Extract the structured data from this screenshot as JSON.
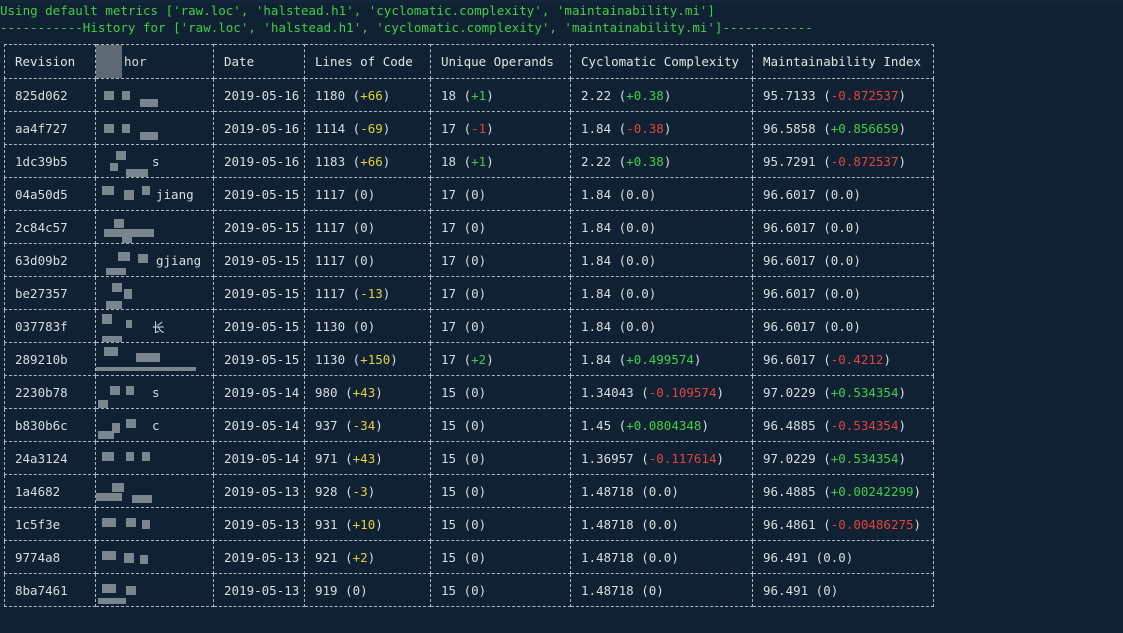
{
  "console": {
    "line1": "Using default metrics ['raw.loc', 'halstead.h1', 'cyclomatic.complexity', 'maintainability.mi']",
    "line2": "-----------History for ['raw.loc', 'halstead.h1', 'cyclomatic.complexity', 'maintainability.mi']------------"
  },
  "table": {
    "headers": [
      "Revision",
      "hor",
      "Date",
      "Lines of Code",
      "Unique Operands",
      "Cyclomatic Complexity",
      "Maintainability Index"
    ],
    "rows": [
      {
        "rev": "825d062",
        "author": "",
        "date": "2019-05-16",
        "loc": "1180",
        "loc_delta": "+66",
        "ops": "18",
        "ops_delta": "+1",
        "cc": "2.22",
        "cc_delta": "+0.38",
        "mi": "95.7133",
        "mi_delta": "-0.872537"
      },
      {
        "rev": "aa4f727",
        "author": "",
        "date": "2019-05-16",
        "loc": "1114",
        "loc_delta": "-69",
        "ops": "17",
        "ops_delta": "-1",
        "cc": "1.84",
        "cc_delta": "-0.38",
        "mi": "96.5858",
        "mi_delta": "+0.856659"
      },
      {
        "rev": "1dc39b5",
        "author": "s",
        "date": "2019-05-16",
        "loc": "1183",
        "loc_delta": "+66",
        "ops": "18",
        "ops_delta": "+1",
        "cc": "2.22",
        "cc_delta": "+0.38",
        "mi": "95.7291",
        "mi_delta": "-0.872537"
      },
      {
        "rev": "04a50d5",
        "author": "jiang",
        "date": "2019-05-15",
        "loc": "1117",
        "loc_delta": "0",
        "ops": "17",
        "ops_delta": "0",
        "cc": "1.84",
        "cc_delta": "0.0",
        "mi": "96.6017",
        "mi_delta": "0.0"
      },
      {
        "rev": "2c84c57",
        "author": "",
        "date": "2019-05-15",
        "loc": "1117",
        "loc_delta": "0",
        "ops": "17",
        "ops_delta": "0",
        "cc": "1.84",
        "cc_delta": "0.0",
        "mi": "96.6017",
        "mi_delta": "0.0"
      },
      {
        "rev": "63d09b2",
        "author": "gjiang",
        "date": "2019-05-15",
        "loc": "1117",
        "loc_delta": "0",
        "ops": "17",
        "ops_delta": "0",
        "cc": "1.84",
        "cc_delta": "0.0",
        "mi": "96.6017",
        "mi_delta": "0.0"
      },
      {
        "rev": "be27357",
        "author": "",
        "date": "2019-05-15",
        "loc": "1117",
        "loc_delta": "-13",
        "ops": "17",
        "ops_delta": "0",
        "cc": "1.84",
        "cc_delta": "0.0",
        "mi": "96.6017",
        "mi_delta": "0.0"
      },
      {
        "rev": "037783f",
        "author": "长",
        "date": "2019-05-15",
        "loc": "1130",
        "loc_delta": "0",
        "ops": "17",
        "ops_delta": "0",
        "cc": "1.84",
        "cc_delta": "0.0",
        "mi": "96.6017",
        "mi_delta": "0.0"
      },
      {
        "rev": "289210b",
        "author": "",
        "date": "2019-05-15",
        "loc": "1130",
        "loc_delta": "+150",
        "ops": "17",
        "ops_delta": "+2",
        "cc": "1.84",
        "cc_delta": "+0.499574",
        "mi": "96.6017",
        "mi_delta": "-0.4212"
      },
      {
        "rev": "2230b78",
        "author": "s",
        "date": "2019-05-14",
        "loc": "980",
        "loc_delta": "+43",
        "ops": "15",
        "ops_delta": "0",
        "cc": "1.34043",
        "cc_delta": "-0.109574",
        "mi": "97.0229",
        "mi_delta": "+0.534354"
      },
      {
        "rev": "b830b6c",
        "author": "c",
        "date": "2019-05-14",
        "loc": "937",
        "loc_delta": "-34",
        "ops": "15",
        "ops_delta": "0",
        "cc": "1.45",
        "cc_delta": "+0.0804348",
        "mi": "96.4885",
        "mi_delta": "-0.534354"
      },
      {
        "rev": "24a3124",
        "author": "",
        "date": "2019-05-14",
        "loc": "971",
        "loc_delta": "+43",
        "ops": "15",
        "ops_delta": "0",
        "cc": "1.36957",
        "cc_delta": "-0.117614",
        "mi": "97.0229",
        "mi_delta": "+0.534354"
      },
      {
        "rev": "1a4682",
        "author": "",
        "date": "2019-05-13",
        "loc": "928",
        "loc_delta": "-3",
        "ops": "15",
        "ops_delta": "0",
        "cc": "1.48718",
        "cc_delta": "0.0",
        "mi": "96.4885",
        "mi_delta": "+0.00242299"
      },
      {
        "rev": "1c5f3e",
        "author": "",
        "date": "2019-05-13",
        "loc": "931",
        "loc_delta": "+10",
        "ops": "15",
        "ops_delta": "0",
        "cc": "1.48718",
        "cc_delta": "0.0",
        "mi": "96.4861",
        "mi_delta": "-0.00486275"
      },
      {
        "rev": "9774a8",
        "author": "",
        "date": "2019-05-13",
        "loc": "921",
        "loc_delta": "+2",
        "ops": "15",
        "ops_delta": "0",
        "cc": "1.48718",
        "cc_delta": "0.0",
        "mi": "96.491",
        "mi_delta": "0.0"
      },
      {
        "rev": "8ba7461",
        "author": "",
        "date": "2019-05-13",
        "loc": "919",
        "loc_delta": "0",
        "ops": "15",
        "ops_delta": "0",
        "cc": "1.48718",
        "cc_delta": "0",
        "mi": "96.491",
        "mi_delta": "0"
      }
    ]
  },
  "colors": {
    "background": "#0f2132",
    "text": "#d7dde3",
    "positive": "#3ecf4a",
    "negative": "#e0443c",
    "loc_change": "#e3d33a",
    "border": "#aeb7c0"
  }
}
